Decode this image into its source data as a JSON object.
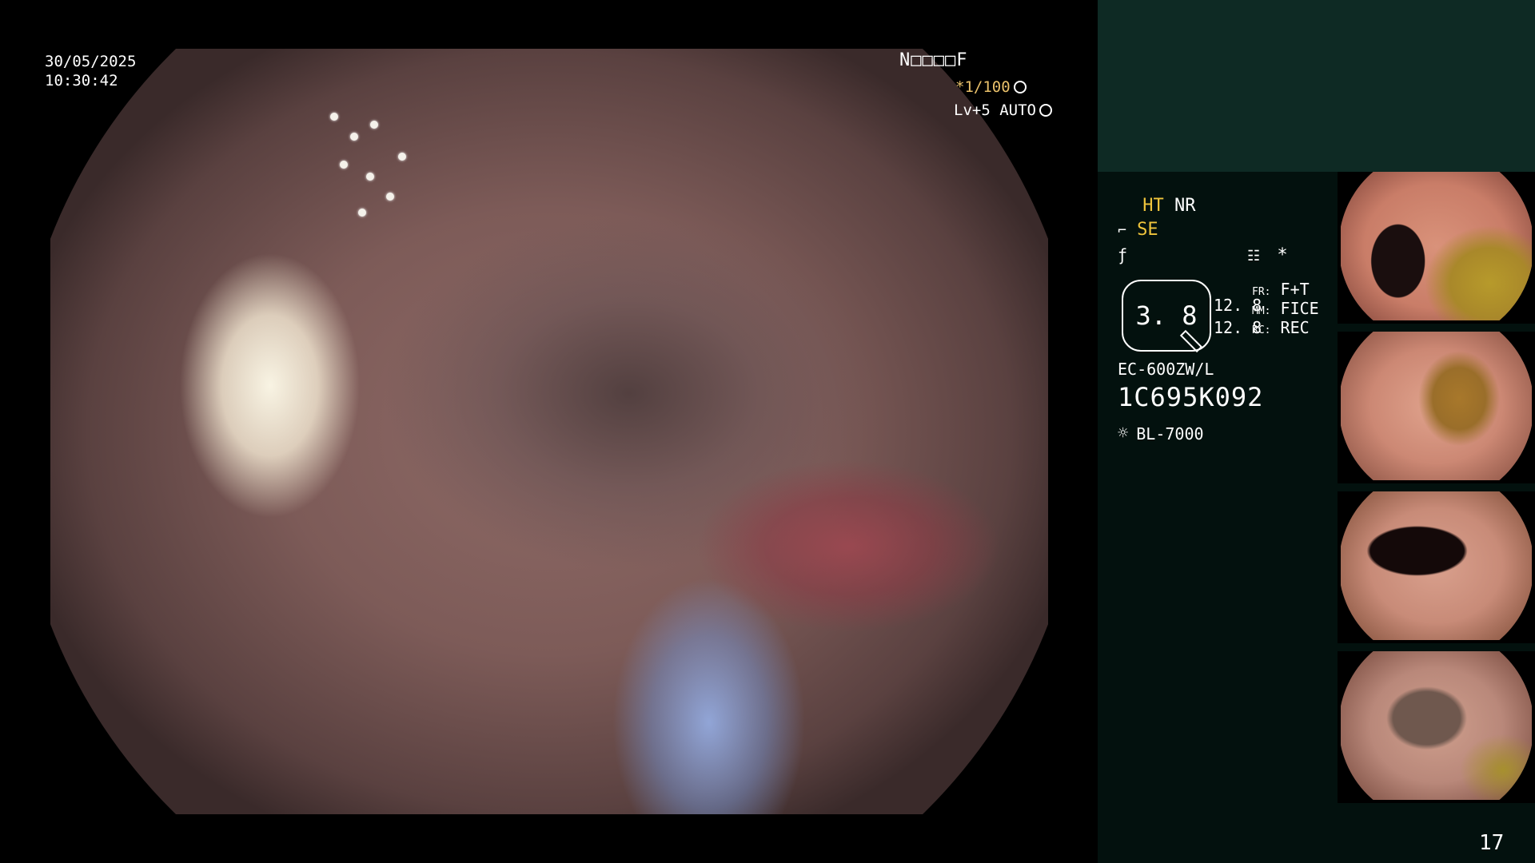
{
  "osd": {
    "date": "30/05/2025",
    "time": "10:30:42",
    "scope_id": "N□□□□F",
    "shutter": "*1/100",
    "level": "Lv+5 AUTO"
  },
  "settings": {
    "ht": "HT",
    "nr": "NR",
    "se": "SE",
    "mode_star": "*",
    "zoom": "3. 8",
    "fr_label": "FR:",
    "fr_value": "F+T",
    "mm_label": "MM:",
    "mm_value": "FICE",
    "rc_label": "RC:",
    "rc_value": "REC",
    "stat1": "12. 8",
    "stat2": "12. 8",
    "model": "EC-600ZW/L",
    "serial": "1C695K092",
    "light": "BL-7000"
  },
  "page_number": "17",
  "colors": {
    "header_bg": "#0e2a24",
    "panel_bg": "#03110e",
    "accent_yellow": "#f0c53c"
  },
  "icons": [
    "shutter-aperture-icon",
    "auto-level-icon",
    "scope-curve-icon",
    "freeze-icon",
    "settings-list-icon",
    "zoom-pencil-icon",
    "light-bulb-icon"
  ]
}
